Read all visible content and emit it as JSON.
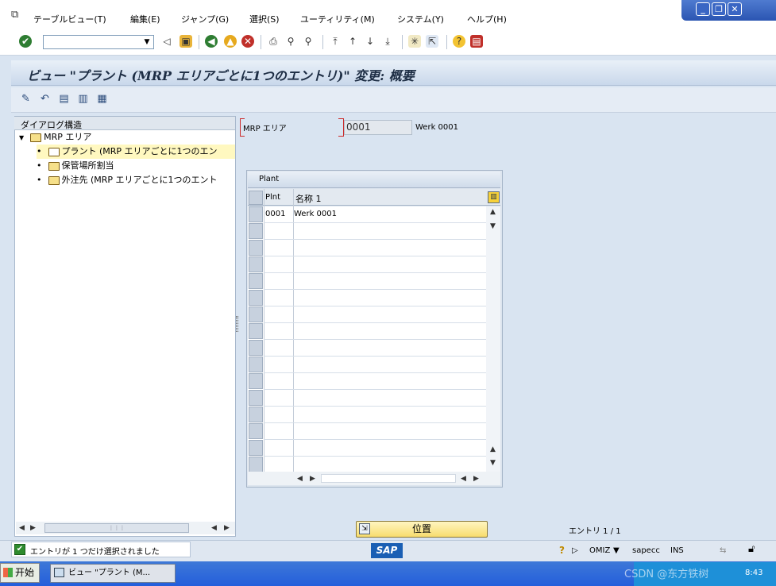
{
  "menu": {
    "items": [
      "テーブルビュー(T)",
      "編集(E)",
      "ジャンプ(G)",
      "選択(S)",
      "ユーティリティ(M)",
      "システム(Y)",
      "ヘルプ(H)"
    ]
  },
  "window_controls": {
    "minimize": "_",
    "restore": "❐",
    "close": "✕"
  },
  "toolbar": {
    "command_field_value": "",
    "icons": [
      "enter-icon",
      "back-icon",
      "save-icon",
      "nav-back-icon",
      "exit-icon",
      "cancel-icon",
      "print-icon",
      "find-icon",
      "find-next-icon",
      "first-page-icon",
      "prev-page-icon",
      "next-page-icon",
      "last-page-icon",
      "new-session-icon",
      "shortcut-icon",
      "help-icon",
      "layout-icon"
    ]
  },
  "page": {
    "title": "ビュー \"プラント (MRP エリアごとに1つのエントリ)\" 変更: 概要"
  },
  "app_toolbar": {
    "icons": [
      "display-change-icon",
      "undo-icon",
      "select-all-icon",
      "select-block-icon",
      "deselect-all-icon"
    ]
  },
  "tree": {
    "header": "ダイアログ構造",
    "root": "MRP エリア",
    "children": [
      "プラント (MRP エリアごとに1つのエン",
      "保管場所割当",
      "外注先 (MRP エリアごとに1つのエント"
    ]
  },
  "header_fields": {
    "mrp_area_label": "MRP エリア",
    "mrp_area_value": "0001",
    "mrp_area_desc": "Werk 0001"
  },
  "table": {
    "title": "Plant",
    "columns": [
      "Plnt",
      "名称 1"
    ],
    "rows": [
      {
        "plnt": "0001",
        "name": "Werk 0001"
      }
    ]
  },
  "position_button": {
    "label": "位置"
  },
  "entry_count": "エントリ 1 / 1",
  "status": {
    "message": "エントリが 1 つだけ選択されました",
    "system": "OMIZ",
    "server": "sapecc",
    "mode": "INS"
  },
  "taskbar": {
    "start_label": "开始",
    "task_label": "ビュー \"プラント (M...",
    "clock": "8:43",
    "watermark": "CSDN @东方铁树"
  },
  "colors": {
    "background": "#d9e4f1",
    "highlight_row": "#fff8c0",
    "position_button": "#f7dc6e",
    "sap_logo": "#1a5fb4",
    "taskbar": "#245edb"
  }
}
